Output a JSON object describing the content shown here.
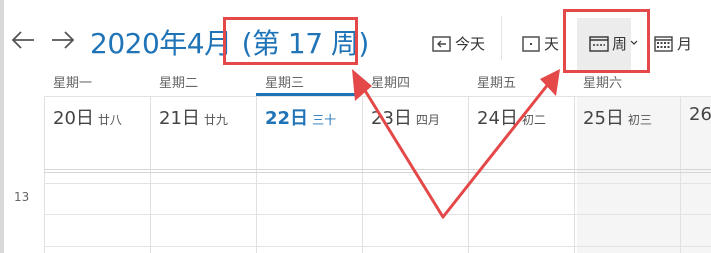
{
  "header": {
    "title_month": "2020年4月",
    "title_week": "(第 17 周)"
  },
  "toolbar": {
    "today_label": "今天",
    "day_label": "天",
    "week_label": "周",
    "month_label": "月"
  },
  "days": [
    {
      "dow": "星期一",
      "date": "20日",
      "lunar": "廿八"
    },
    {
      "dow": "星期二",
      "date": "21日",
      "lunar": "廿九"
    },
    {
      "dow": "星期三",
      "date": "22日",
      "lunar": "三十"
    },
    {
      "dow": "星期四",
      "date": "23日",
      "lunar": "四月"
    },
    {
      "dow": "星期五",
      "date": "24日",
      "lunar": "初二"
    },
    {
      "dow": "星期六",
      "date": "25日",
      "lunar": "初三"
    },
    {
      "dow": "",
      "date": "26",
      "lunar": ""
    }
  ],
  "time_labels": [
    "13"
  ],
  "colors": {
    "accent": "#1f73b7",
    "annotation": "#e44848"
  }
}
